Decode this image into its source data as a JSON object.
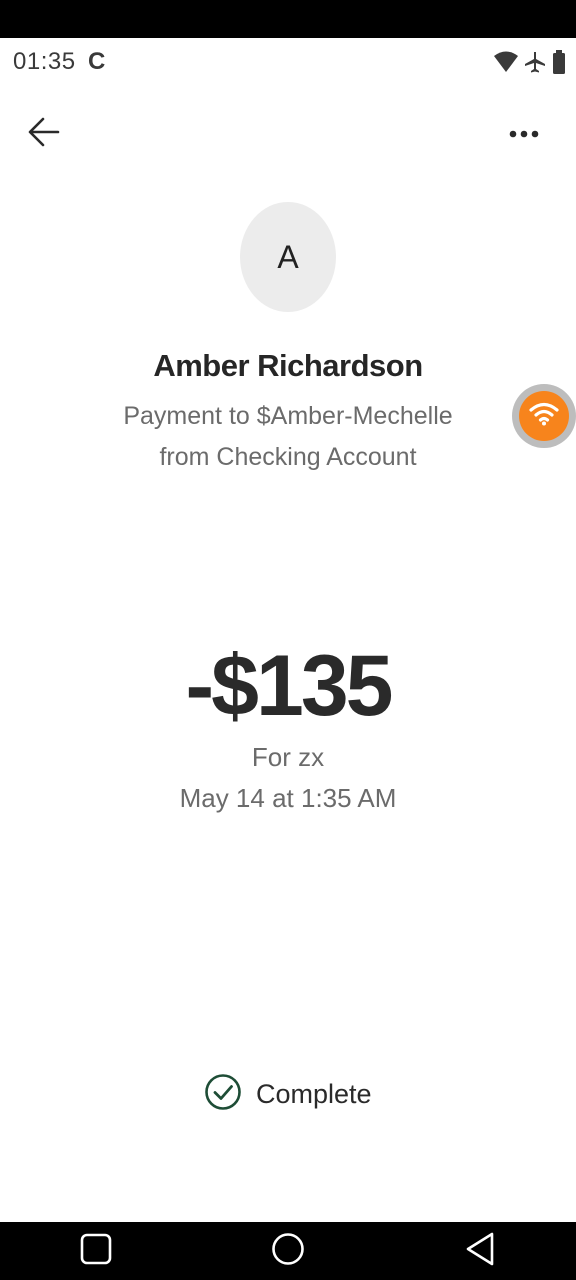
{
  "status_bar": {
    "time": "01:35",
    "app_indicator": "C",
    "icons": [
      "wifi-icon",
      "airplane-mode-icon",
      "battery-icon"
    ]
  },
  "header": {
    "back_icon": "arrow-left-icon",
    "more_icon": "more-horizontal-icon"
  },
  "recipient": {
    "avatar_initial": "A",
    "name": "Amber Richardson",
    "description_line1": "Payment to $Amber-Mechelle",
    "description_line2": "from Checking Account"
  },
  "transaction": {
    "amount": "-$135",
    "memo": "For zx",
    "date": "May 14 at 1:35 AM",
    "status": "Complete"
  },
  "floating_bubble": {
    "icon": "wifi-icon",
    "color": "#f7841c"
  },
  "colors": {
    "status_check": "#1e4d36"
  },
  "nav_bar": {
    "icons": [
      "recents-square-icon",
      "home-circle-icon",
      "back-triangle-icon"
    ]
  }
}
